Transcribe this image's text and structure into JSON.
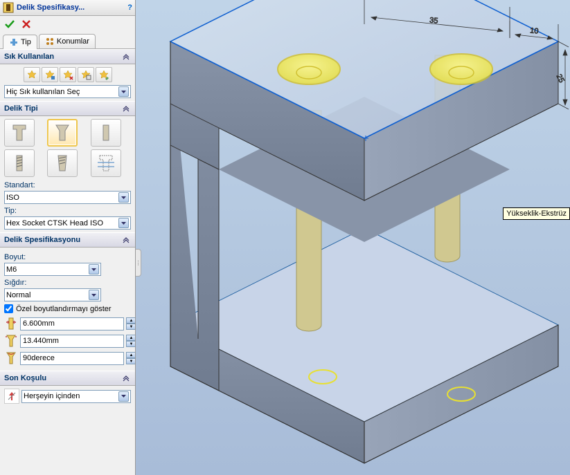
{
  "panel": {
    "title": "Delik Spesifikasy...",
    "help": "?"
  },
  "tabs": {
    "tip": "Tip",
    "konumlar": "Konumlar"
  },
  "groups": {
    "favorites": {
      "title": "Sık Kullanılan",
      "dropdown": "Hiç Sık kullanılan Seç"
    },
    "holetype": {
      "title": "Delik Tipi",
      "standard_label": "Standart:",
      "standard_value": "ISO",
      "tip_label": "Tip:",
      "tip_value": "Hex Socket CTSK Head ISO"
    },
    "holespec": {
      "title": "Delik Spesifikasyonu",
      "size_label": "Boyut:",
      "size_value": "M6",
      "fit_label": "Sığdır:",
      "fit_value": "Normal",
      "custom_check": "Özel boyutlandırmayı göster",
      "dim1": "6.600mm",
      "dim2": "13.440mm",
      "dim3": "90derece"
    },
    "endcond": {
      "title": "Son Koşulu",
      "value": "Herşeyin içinden"
    }
  },
  "viewport": {
    "dim1": "35",
    "dim2": "10",
    "dim3": "25",
    "callout": "Yükseklik-Ekstrüz"
  }
}
